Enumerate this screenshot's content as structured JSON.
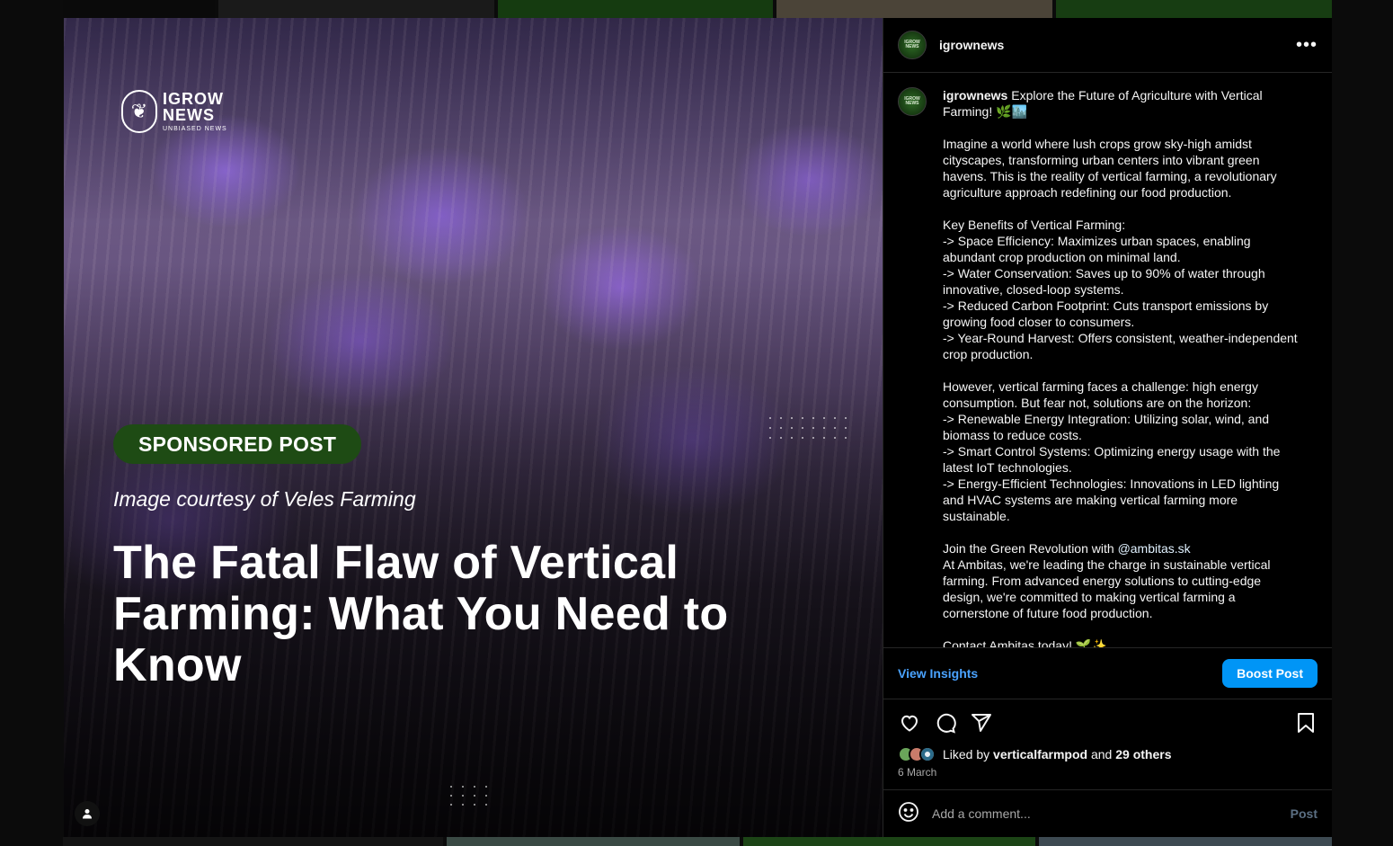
{
  "colors": {
    "accent": "#0095f6",
    "link": "#4aa3ff",
    "badge": "#1e4b14",
    "panel_bg": "#000000",
    "divider": "#262626"
  },
  "media": {
    "logo": {
      "line1": "IGROW",
      "line2": "NEWS",
      "tagline": "UNBIASED NEWS"
    },
    "badge": "SPONSORED POST",
    "courtesy": "Image courtesy of Veles Farming",
    "headline": "The Fatal Flaw of Vertical Farming: What You Need to Know"
  },
  "header": {
    "username": "igrownews",
    "more_icon": "more-horizontal-icon"
  },
  "caption": {
    "username": "igrownews",
    "intro": "Explore the Future of Agriculture with Vertical Farming! 🌿🏙️",
    "para1": "Imagine a world where lush crops grow sky-high amidst cityscapes, transforming urban centers into vibrant green havens. This is the reality of vertical farming, a revolutionary agriculture approach redefining our food production.",
    "benefits_title": "Key Benefits of Vertical Farming:",
    "benefits": [
      "-> Space Efficiency: Maximizes urban spaces, enabling abundant crop production on minimal land.",
      "-> Water Conservation: Saves up to 90% of water through innovative, closed-loop systems.",
      "-> Reduced Carbon Footprint: Cuts transport emissions by growing food closer to consumers.",
      "-> Year-Round Harvest: Offers consistent, weather-independent crop production."
    ],
    "challenge": "However, vertical farming faces a challenge: high energy consumption. But fear not, solutions are on the horizon:",
    "solutions": [
      "-> Renewable Energy Integration: Utilizing solar, wind, and biomass to reduce costs.",
      "-> Smart Control Systems: Optimizing energy usage with the latest IoT technologies.",
      "-> Energy-Efficient Technologies: Innovations in LED lighting and HVAC systems are making vertical farming more sustainable."
    ],
    "join_prefix": "Join the Green Revolution with ",
    "join_mention": "@ambitas.sk",
    "ambitas": "At Ambitas, we're leading the charge in sustainable vertical farming. From advanced energy solutions to cutting-edge design, we're committed to making vertical farming a cornerstone of future food production.",
    "cutoff": "Contact Ambitas today! 🌱✨"
  },
  "insights": {
    "view_label": "View Insights",
    "boost_label": "Boost Post"
  },
  "actions": {
    "icons": [
      "heart-icon",
      "comment-icon",
      "share-icon",
      "bookmark-icon"
    ]
  },
  "likes": {
    "prefix": "Liked by",
    "user": "verticalfarmpod",
    "joiner": "and",
    "others": "29 others"
  },
  "date": "6 March",
  "comment": {
    "placeholder": "Add a comment...",
    "post_label": "Post"
  }
}
